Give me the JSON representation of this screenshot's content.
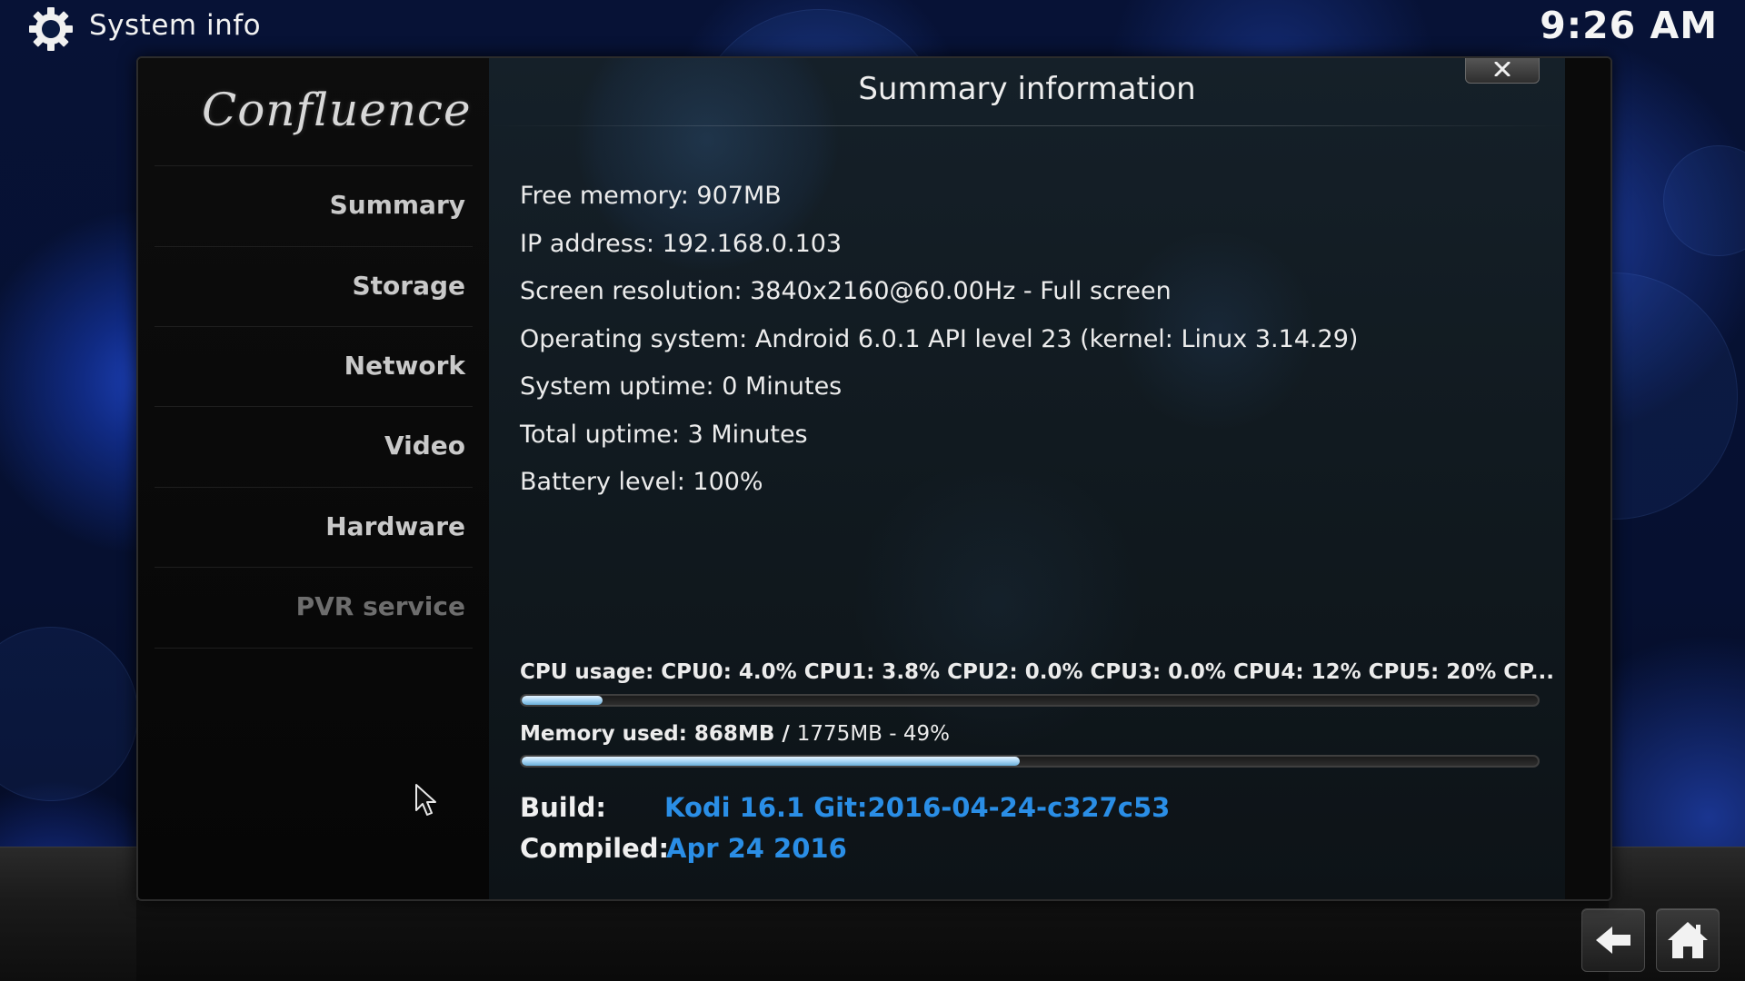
{
  "header": {
    "title": "System info",
    "clock": "9:26 AM",
    "icon": "gear-icon"
  },
  "sidebar": {
    "logo_text": "Confluence",
    "items": [
      {
        "label": "Summary"
      },
      {
        "label": "Storage"
      },
      {
        "label": "Network"
      },
      {
        "label": "Video"
      },
      {
        "label": "Hardware"
      },
      {
        "label": "PVR service"
      }
    ]
  },
  "content": {
    "title": "Summary information",
    "close_icon": "close-icon",
    "info_lines": [
      "Free memory: 907MB",
      "IP address: 192.168.0.103",
      "Screen resolution: 3840x2160@60.00Hz - Full screen",
      "Operating system: Android 6.0.1 API level 23 (kernel: Linux 3.14.29)",
      "System uptime: 0 Minutes",
      "Total uptime: 3 Minutes",
      "Battery level: 100%"
    ],
    "cpu": {
      "label": "CPU usage: CPU0: 4.0% CPU1: 3.8% CPU2: 0.0% CPU3: 0.0% CPU4:  12% CPU5:  20% CP...",
      "bar_percent": 8
    },
    "memory": {
      "label_bold": "Memory used: 868MB / ",
      "label_rest": "1775MB - 49%",
      "bar_percent": 49
    },
    "build": {
      "label": "Build:",
      "value": "Kodi 16.1 Git:2016-04-24-c327c53"
    },
    "compiled": {
      "label": "Compiled:",
      "value": "Apr 24 2016"
    }
  },
  "footer": {
    "back_icon": "back-arrow-icon",
    "home_icon": "home-icon"
  },
  "colors": {
    "accent_link": "#2a8ee6",
    "bar_fill": "#a9d6f5"
  }
}
